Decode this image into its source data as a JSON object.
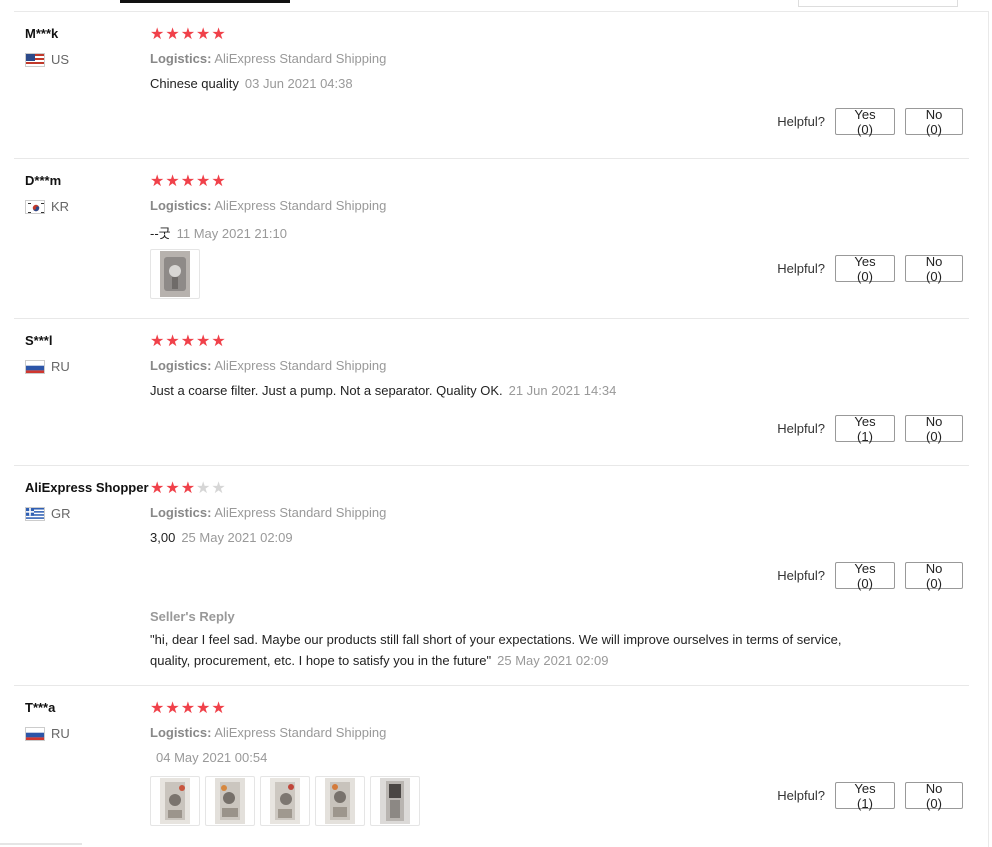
{
  "helpful_label": "Helpful?",
  "logistics_label": "Logistics:",
  "reviews": [
    {
      "user": "M***k",
      "country": "US",
      "flag_icon": "us-flag-icon",
      "rating": 5,
      "shipping": "AliExpress Standard Shipping",
      "text": "Chinese quality",
      "date": "03 Jun 2021 04:38",
      "yes": "Yes (0)",
      "no": "No (0)"
    },
    {
      "user": "D***m",
      "country": "KR",
      "flag_icon": "kr-flag-icon",
      "rating": 5,
      "shipping": "AliExpress Standard Shipping",
      "text": "--굿",
      "date": "11 May 2021 21:10",
      "yes": "Yes (0)",
      "no": "No (0)",
      "photos": 1
    },
    {
      "user": "S***l",
      "country": "RU",
      "flag_icon": "ru-flag-icon",
      "rating": 5,
      "shipping": "AliExpress Standard Shipping",
      "text": "Just a coarse filter. Just a pump. Not a separator. Quality OK.",
      "date": "21 Jun 2021 14:34",
      "yes": "Yes (1)",
      "no": "No (0)"
    },
    {
      "user": "AliExpress Shopper",
      "country": "GR",
      "flag_icon": "gr-flag-icon",
      "rating": 3,
      "shipping": "AliExpress Standard Shipping",
      "text": "3,00",
      "date": "25 May 2021 02:09",
      "yes": "Yes (0)",
      "no": "No (0)",
      "seller_reply": {
        "title": "Seller's Reply",
        "text": "\"hi, dear I feel sad. Maybe our products still fall short of your expectations. We will improve ourselves in terms of service, quality, procurement, etc. I hope to satisfy you in the future\"",
        "date": "25 May 2021 02:09"
      }
    },
    {
      "user": "T***a",
      "country": "RU",
      "flag_icon": "ru-flag-icon",
      "rating": 5,
      "shipping": "AliExpress Standard Shipping",
      "text": "",
      "date": "04 May 2021 00:54",
      "yes": "Yes (1)",
      "no": "No (0)",
      "photos": 5
    }
  ],
  "colors": {
    "star_on": "#f0414a",
    "star_off": "#d6d6d6",
    "muted_text": "#999999"
  }
}
